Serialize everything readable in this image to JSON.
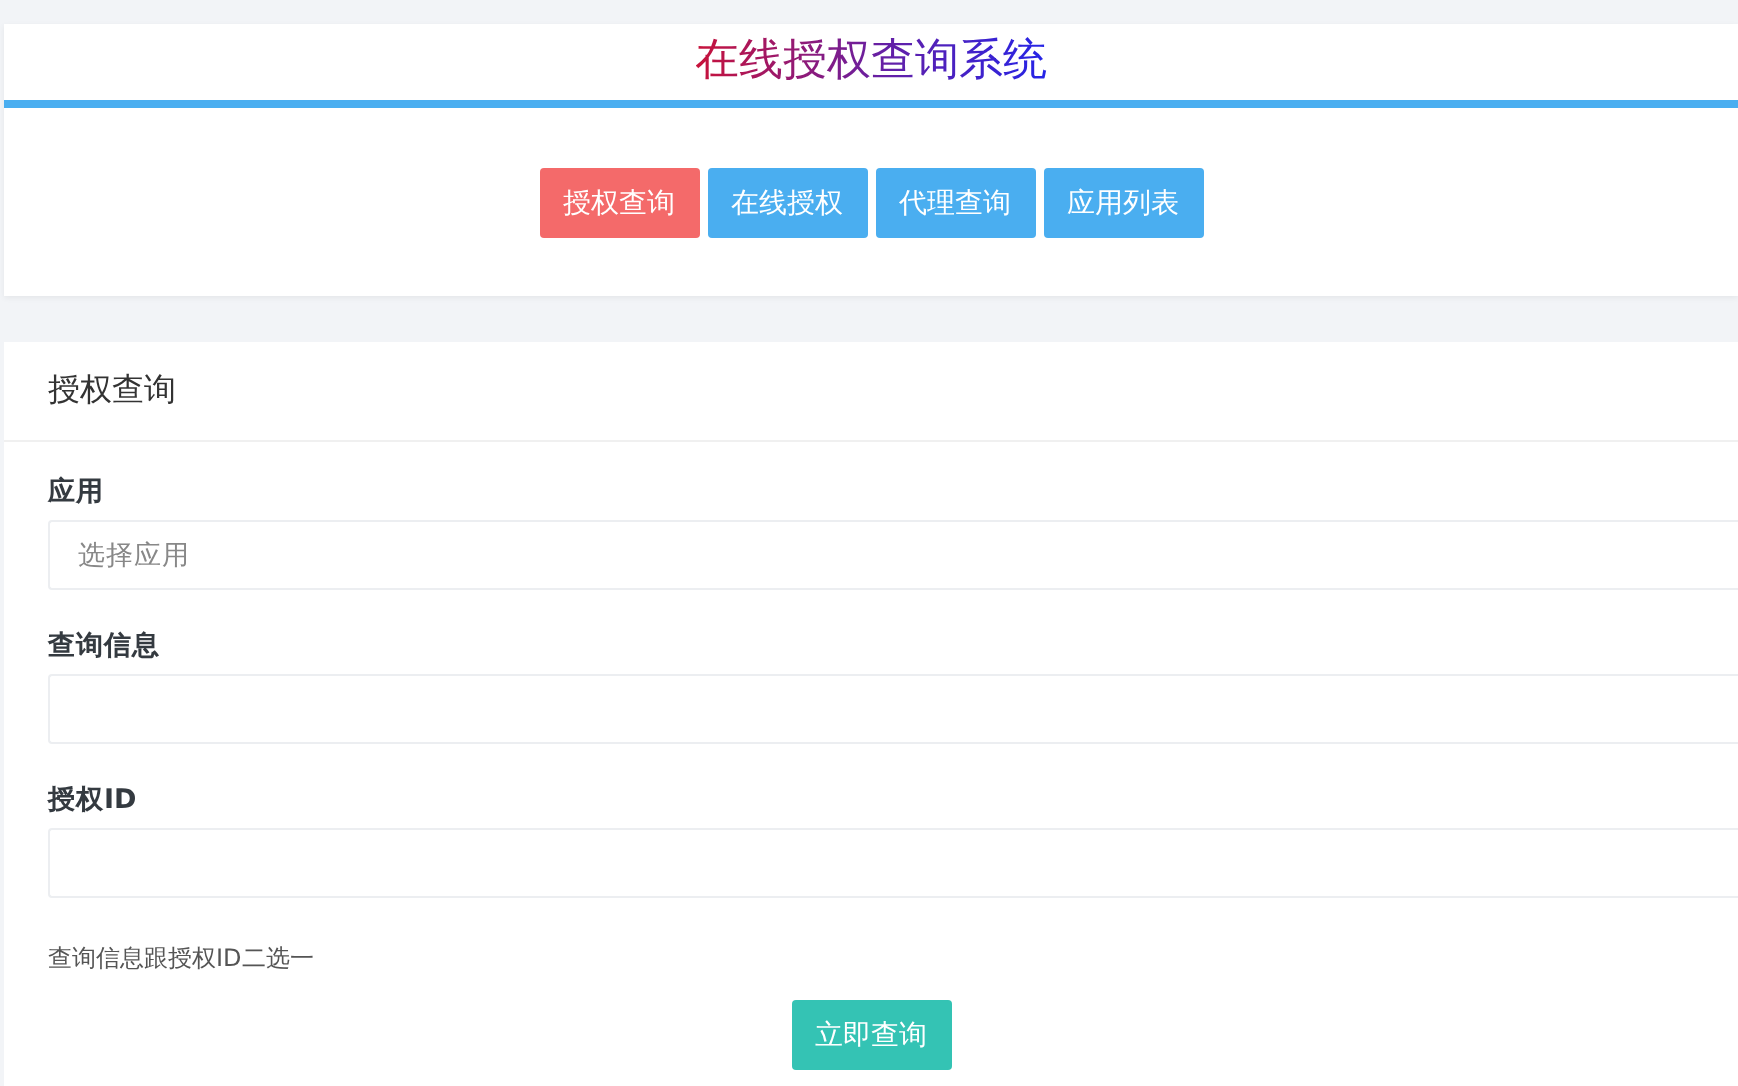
{
  "header": {
    "title": "在线授权查询系统"
  },
  "nav": [
    {
      "label": "授权查询",
      "selected": true
    },
    {
      "label": "在线授权",
      "selected": false
    },
    {
      "label": "代理查询",
      "selected": false
    },
    {
      "label": "应用列表",
      "selected": false
    }
  ],
  "form": {
    "title": "授权查询",
    "fields": [
      {
        "label": "应用",
        "placeholder": "选择应用"
      },
      {
        "label": "查询信息"
      },
      {
        "label": "授权ID"
      }
    ],
    "help": "查询信息跟授权ID二选一",
    "submit": "立即查询"
  }
}
